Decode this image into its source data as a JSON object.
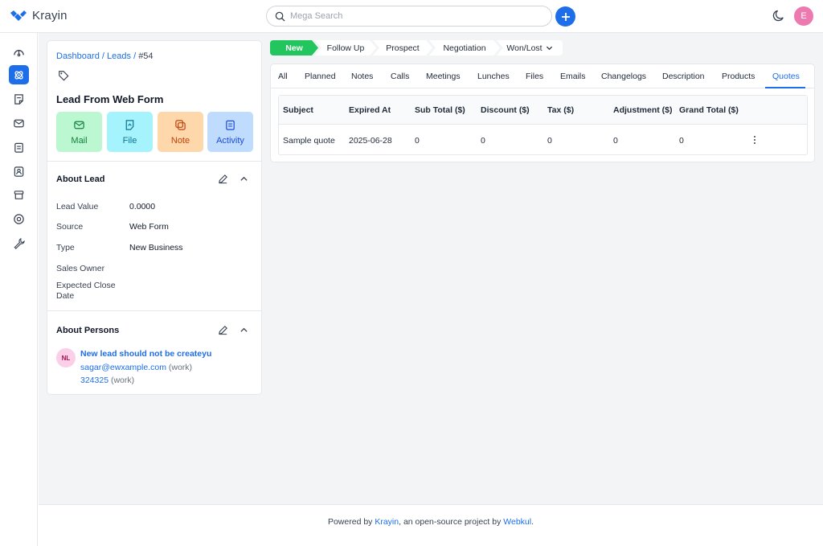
{
  "app": {
    "name": "Krayin",
    "user_initial": "E"
  },
  "search": {
    "placeholder": "Mega Search"
  },
  "nav": [
    "dashboard-icon",
    "leads-icon",
    "quotes-icon",
    "mail-icon",
    "activities-icon",
    "contacts-icon",
    "products-icon",
    "settings-icon",
    "configuration-icon"
  ],
  "breadcrumb": {
    "dashboard": "Dashboard",
    "sep": "/",
    "leads": "Leads",
    "current": "#54"
  },
  "lead": {
    "title": "Lead From Web Form",
    "actions": {
      "mail": "Mail",
      "file": "File",
      "note": "Note",
      "activity": "Activity"
    }
  },
  "about_lead": {
    "title": "About Lead",
    "fields": [
      {
        "label": "Lead Value",
        "value": "0.0000"
      },
      {
        "label": "Source",
        "value": "Web Form"
      },
      {
        "label": "Type",
        "value": "New Business"
      },
      {
        "label": "Sales Owner",
        "value": ""
      },
      {
        "label": "Expected Close Date",
        "value": ""
      }
    ]
  },
  "about_persons": {
    "title": "About Persons",
    "person": {
      "initials": "NL",
      "name": "New lead should not be createyu",
      "email": "sagar@ewxample.com",
      "email_tag": "(work)",
      "phone": "324325",
      "phone_tag": "(work)"
    }
  },
  "stages": [
    "New",
    "Follow Up",
    "Prospect",
    "Negotiation",
    "Won/Lost"
  ],
  "tabs": [
    "All",
    "Planned",
    "Notes",
    "Calls",
    "Meetings",
    "Lunches",
    "Files",
    "Emails",
    "Changelogs",
    "Description",
    "Products",
    "Quotes"
  ],
  "quotes_table": {
    "headers": [
      "Subject",
      "Expired At",
      "Sub Total ($)",
      "Discount ($)",
      "Tax ($)",
      "Adjustment ($)",
      "Grand Total ($)"
    ],
    "rows": [
      [
        "Sample quote",
        "2025-06-28",
        "0",
        "0",
        "0",
        "0",
        "0"
      ]
    ]
  },
  "footer": {
    "prefix": "Powered by",
    "krayin": "Krayin",
    "middle": ", an open-source project by",
    "webkul": "Webkul",
    "suffix": "."
  },
  "colors": {
    "accent": "#1d6ee8",
    "stage_active": "#22c55e",
    "avatar": "#ec79b0"
  }
}
